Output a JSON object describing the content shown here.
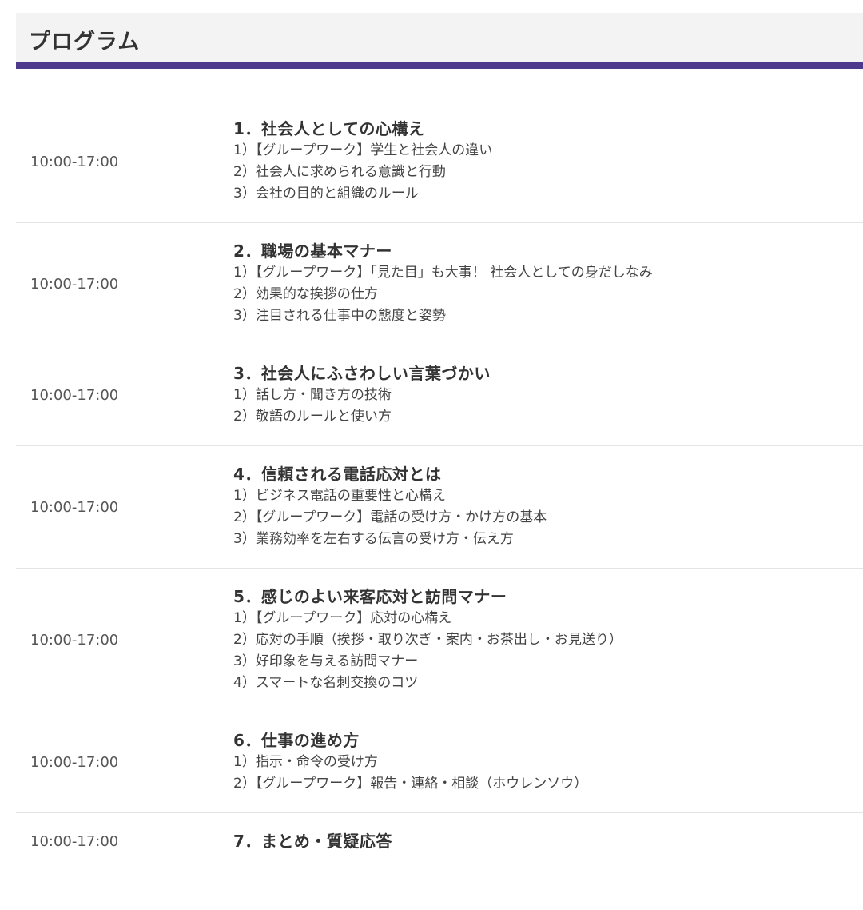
{
  "header": {
    "title": "プログラム"
  },
  "sessions": [
    {
      "time": "10:00-17:00",
      "title": "1．社会人としての心構え",
      "items": [
        "1）【グループワーク】学生と社会人の違い",
        "2）社会人に求められる意識と行動",
        "3）会社の目的と組織のルール"
      ]
    },
    {
      "time": "10:00-17:00",
      "title": "2．職場の基本マナー",
      "items": [
        "1）【グループワーク】「見た目」も大事！ 社会人としての身だしなみ",
        "2）効果的な挨拶の仕方",
        "3）注目される仕事中の態度と姿勢"
      ]
    },
    {
      "time": "10:00-17:00",
      "title": "3．社会人にふさわしい言葉づかい",
      "items": [
        "1）話し方・聞き方の技術",
        "2）敬語のルールと使い方"
      ]
    },
    {
      "time": "10:00-17:00",
      "title": "4．信頼される電話応対とは",
      "items": [
        "1）ビジネス電話の重要性と心構え",
        "2）【グループワーク】電話の受け方・かけ方の基本",
        "3）業務効率を左右する伝言の受け方・伝え方"
      ]
    },
    {
      "time": "10:00-17:00",
      "title": "5．感じのよい来客応対と訪問マナー",
      "items": [
        "1）【グループワーク】応対の心構え",
        "2）応対の手順（挨拶・取り次ぎ・案内・お茶出し・お見送り）",
        "3）好印象を与える訪問マナー",
        "4）スマートな名刺交換のコツ"
      ]
    },
    {
      "time": "10:00-17:00",
      "title": "6．仕事の進め方",
      "items": [
        "1）指示・命令の受け方",
        "2）【グループワーク】報告・連絡・相談（ホウレンソウ）"
      ]
    },
    {
      "time": "10:00-17:00",
      "title": "7．まとめ・質疑応答",
      "items": []
    }
  ],
  "colors": {
    "accent": "#4e3a8c",
    "header_bg": "#f3f3f3",
    "divider": "#e4e4e4"
  }
}
